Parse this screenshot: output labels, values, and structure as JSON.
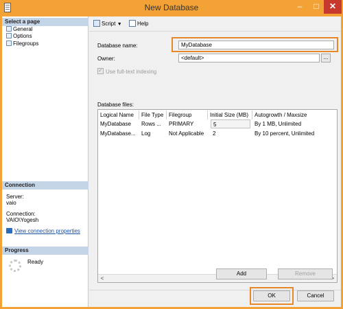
{
  "window": {
    "title": "New Database",
    "min_glyph": "–",
    "max_glyph": "□",
    "close_glyph": "✕"
  },
  "left_pane": {
    "select_page_header": "Select a page",
    "pages": [
      {
        "label": "General",
        "icon": "page-icon"
      },
      {
        "label": "Options",
        "icon": "page-icon"
      },
      {
        "label": "Filegroups",
        "icon": "page-icon"
      }
    ],
    "connection_header": "Connection",
    "server_label": "Server:",
    "server_value": "vaio",
    "connection_label": "Connection:",
    "connection_value": "VAIO\\Yogesh",
    "view_connection_link": "View connection properties",
    "progress_header": "Progress",
    "progress_status": "Ready"
  },
  "toolbar": {
    "script_label": "Script",
    "help_label": "Help"
  },
  "form": {
    "db_name_label": "Database name:",
    "db_name_value": "MyDatabase",
    "owner_label": "Owner:",
    "owner_value": "<default>",
    "owner_browse": "...",
    "fulltext_label": "Use full-text indexing",
    "files_label": "Database files:"
  },
  "files_table": {
    "columns": [
      "Logical Name",
      "File Type",
      "Filegroup",
      "Initial Size (MB)",
      "Autogrowth / Maxsize"
    ],
    "rows": [
      [
        "MyDatabase",
        "Rows ...",
        "PRIMARY",
        "5",
        "By 1 MB, Unlimited"
      ],
      [
        "MyDatabase...",
        "Log",
        "Not Applicable",
        "2",
        "By 10 percent, Unlimited"
      ]
    ]
  },
  "buttons": {
    "add": "Add",
    "remove": "Remove",
    "ok": "OK",
    "cancel": "Cancel"
  },
  "colors": {
    "accent": "#f3a236",
    "highlight": "#e8862a",
    "section_header": "#c5d5e8"
  }
}
